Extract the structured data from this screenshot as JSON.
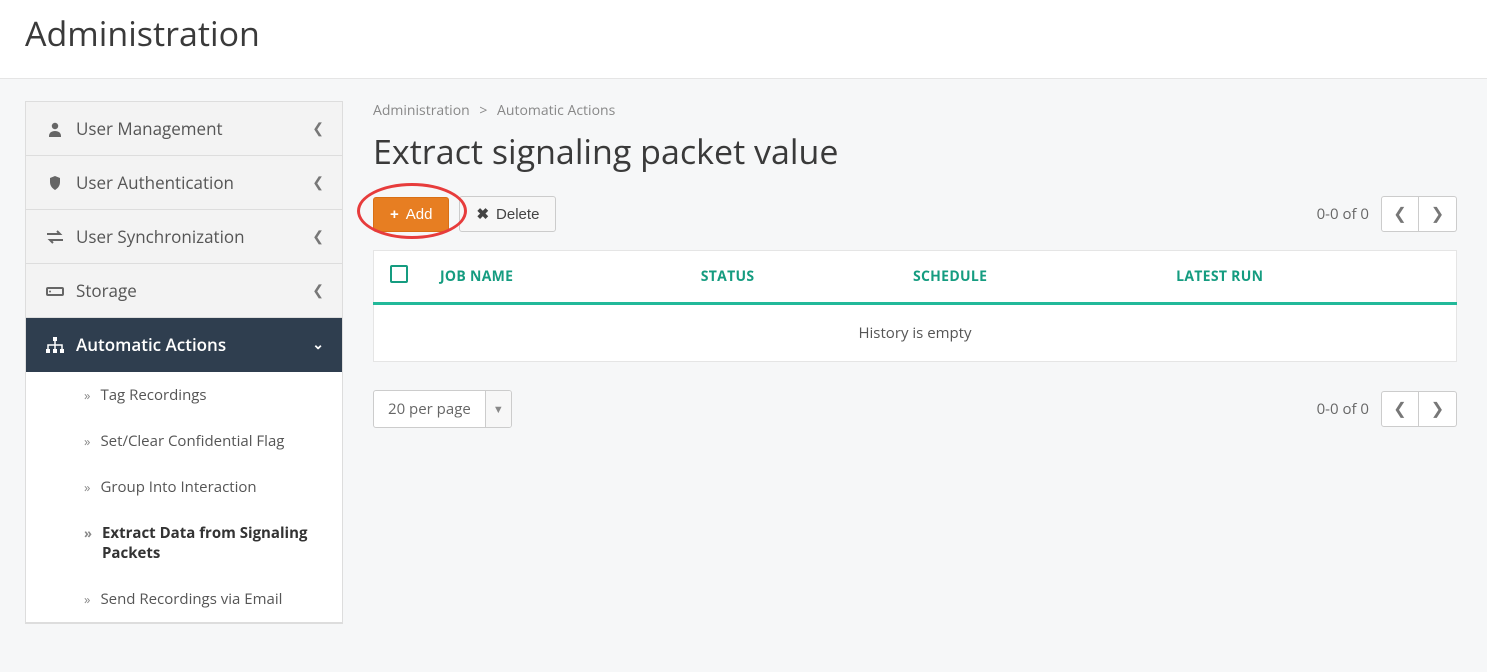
{
  "header": {
    "title": "Administration"
  },
  "sidebar": {
    "items": [
      {
        "label": "User Management"
      },
      {
        "label": "User Authentication"
      },
      {
        "label": "User Synchronization"
      },
      {
        "label": "Storage"
      },
      {
        "label": "Automatic Actions"
      }
    ],
    "sub_items": [
      {
        "label": "Tag Recordings"
      },
      {
        "label": "Set/Clear Confidential Flag"
      },
      {
        "label": "Group Into Interaction"
      },
      {
        "label": "Extract Data from Signaling Packets"
      },
      {
        "label": "Send Recordings via Email"
      }
    ]
  },
  "breadcrumb": {
    "a": "Administration",
    "sep": ">",
    "b": "Automatic Actions"
  },
  "page": {
    "title": "Extract signaling packet value"
  },
  "toolbar": {
    "add": "Add",
    "delete": "Delete"
  },
  "pager": {
    "range": "0-0 of 0"
  },
  "table": {
    "columns": {
      "job": "JOB NAME",
      "status": "STATUS",
      "schedule": "SCHEDULE",
      "latest": "LATEST RUN"
    },
    "empty": "History is empty"
  },
  "per_page": {
    "label": "20 per page"
  }
}
